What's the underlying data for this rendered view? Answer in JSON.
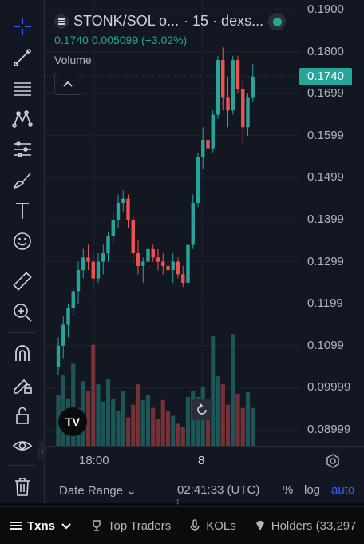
{
  "header": {
    "symbol": "STONK/SOL o...",
    "interval_source": "· 15 · dexs...",
    "ohlc": "0.1740  0.005099 (+3.02%)",
    "volume_label": "Volume"
  },
  "price_axis": {
    "labels": [
      "0.1900",
      "0.1800",
      "0.1699",
      "0.1599",
      "0.1499",
      "0.1399",
      "0.1299",
      "0.1199",
      "0.1099",
      "0.09999",
      "0.08999"
    ],
    "current_price": "0.1740"
  },
  "time_axis": {
    "labels": [
      "18:00",
      "8"
    ]
  },
  "bottom_bar": {
    "date_range": "Date Range",
    "clock": "02:41:33 (UTC)",
    "percent": "%",
    "log": "log",
    "auto": "auto"
  },
  "tabs": [
    {
      "label": "Txns",
      "icon": "list-icon",
      "active": true
    },
    {
      "label": "Top Traders",
      "icon": "trophy-icon",
      "active": false
    },
    {
      "label": "KOLs",
      "icon": "microphone-icon",
      "active": false
    },
    {
      "label": "Holders (33,297",
      "icon": "diamond-icon",
      "active": false
    }
  ],
  "colors": {
    "up": "#26a69a",
    "down": "#ef5350",
    "accent": "#2962ff"
  },
  "chart_data": {
    "type": "candlestick",
    "ylim": [
      0.085,
      0.19
    ],
    "series": [
      {
        "values": [
          [
            0.105,
            0.112,
            0.103,
            0.11
          ],
          [
            0.11,
            0.117,
            0.107,
            0.115
          ],
          [
            0.115,
            0.12,
            0.112,
            0.119
          ],
          [
            0.119,
            0.124,
            0.117,
            0.123
          ],
          [
            0.123,
            0.13,
            0.12,
            0.128
          ],
          [
            0.128,
            0.133,
            0.126,
            0.131
          ],
          [
            0.131,
            0.134,
            0.128,
            0.13
          ],
          [
            0.13,
            0.132,
            0.124,
            0.126
          ],
          [
            0.126,
            0.132,
            0.125,
            0.13
          ],
          [
            0.13,
            0.134,
            0.127,
            0.132
          ],
          [
            0.132,
            0.137,
            0.13,
            0.136
          ],
          [
            0.136,
            0.142,
            0.134,
            0.14
          ],
          [
            0.14,
            0.146,
            0.138,
            0.144
          ],
          [
            0.144,
            0.147,
            0.142,
            0.145
          ],
          [
            0.145,
            0.146,
            0.138,
            0.14
          ],
          [
            0.14,
            0.141,
            0.13,
            0.132
          ],
          [
            0.132,
            0.135,
            0.127,
            0.129
          ],
          [
            0.129,
            0.131,
            0.125,
            0.13
          ],
          [
            0.13,
            0.134,
            0.129,
            0.133
          ],
          [
            0.133,
            0.134,
            0.13,
            0.131
          ],
          [
            0.131,
            0.133,
            0.128,
            0.13
          ],
          [
            0.13,
            0.132,
            0.127,
            0.129
          ],
          [
            0.129,
            0.131,
            0.126,
            0.128
          ],
          [
            0.128,
            0.132,
            0.125,
            0.13
          ],
          [
            0.13,
            0.131,
            0.126,
            0.127
          ],
          [
            0.127,
            0.129,
            0.124,
            0.125
          ],
          [
            0.125,
            0.136,
            0.124,
            0.134
          ],
          [
            0.134,
            0.146,
            0.133,
            0.144
          ],
          [
            0.144,
            0.156,
            0.143,
            0.155
          ],
          [
            0.155,
            0.162,
            0.152,
            0.159
          ],
          [
            0.159,
            0.161,
            0.155,
            0.157
          ],
          [
            0.157,
            0.166,
            0.156,
            0.165
          ],
          [
            0.165,
            0.179,
            0.164,
            0.178
          ],
          [
            0.178,
            0.181,
            0.166,
            0.169
          ],
          [
            0.169,
            0.174,
            0.162,
            0.166
          ],
          [
            0.166,
            0.179,
            0.165,
            0.178
          ],
          [
            0.178,
            0.179,
            0.17,
            0.171
          ],
          [
            0.171,
            0.173,
            0.158,
            0.162
          ],
          [
            0.162,
            0.17,
            0.16,
            0.169
          ],
          [
            0.169,
            0.177,
            0.168,
            0.174
          ]
        ]
      },
      {
        "name": "Volume",
        "values": [
          3.2,
          4.5,
          3.0,
          5.2,
          2.4,
          4.1,
          3.5,
          6.4,
          3.9,
          2.8,
          4.2,
          3.0,
          2.2,
          3.5,
          1.8,
          2.6,
          3.9,
          2.9,
          3.2,
          2.4,
          1.7,
          2.9,
          2.2,
          1.9,
          1.4,
          1.2,
          3.1,
          3.5,
          3.1,
          3.7,
          2.7,
          7.0,
          4.4,
          3.9,
          2.6,
          7.1,
          3.3,
          2.4,
          3.4,
          2.4
        ]
      }
    ]
  }
}
